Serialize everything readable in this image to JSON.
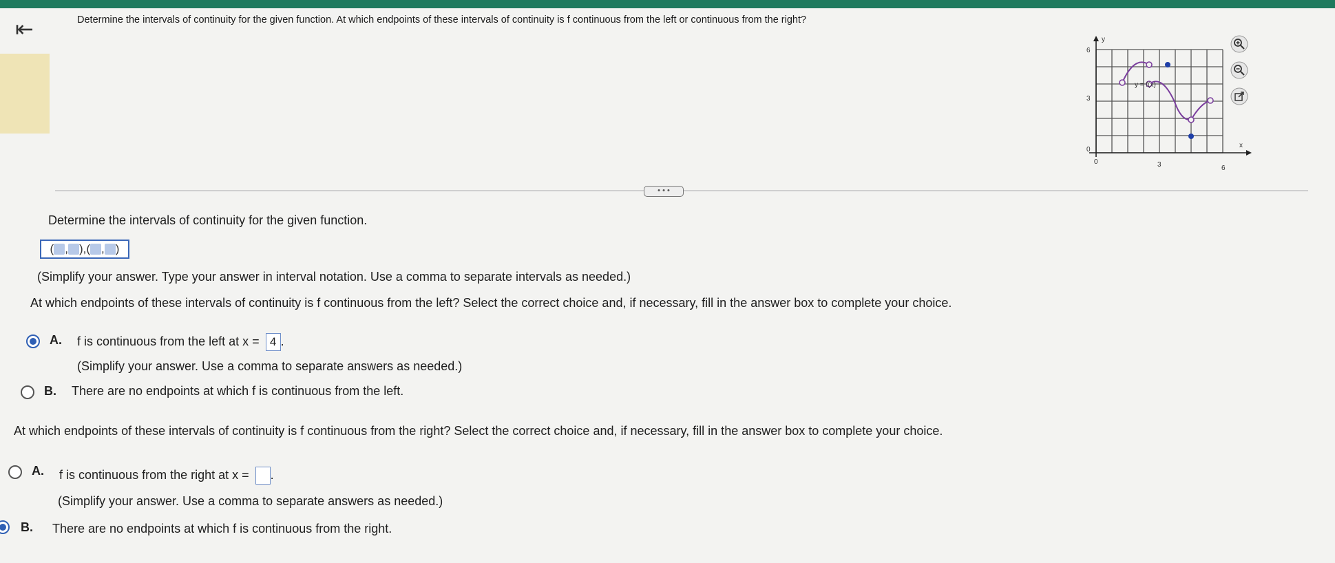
{
  "header": {
    "back_icon": "back-arrow-icon",
    "question": "Determine the intervals of continuity for the given function. At which endpoints of these intervals of continuity is f continuous from the left or continuous from the right?"
  },
  "graph": {
    "y_axis_label": "y",
    "x_axis_label": "x",
    "y_ticks": [
      "6",
      "3",
      "0"
    ],
    "x_ticks": [
      "0",
      "3",
      "6"
    ],
    "function_label": "y = f(x)",
    "colors": {
      "curve": "#7b3f9e",
      "point": "#1f3fa8",
      "grid": "#444444"
    }
  },
  "tools": [
    "zoom-in-icon",
    "zoom-out-icon",
    "popout-icon"
  ],
  "more_button": "• • •",
  "part1": {
    "prompt": "Determine the intervals of continuity for the given function.",
    "answer_template": {
      "open": "(",
      "comma": ",",
      "close": ")",
      "separator": ",",
      "ph1": "",
      "ph2": "",
      "ph3": "",
      "ph4": ""
    },
    "instruction": "(Simplify your answer. Type your answer in interval notation. Use a comma to separate intervals as needed.)"
  },
  "part2": {
    "prompt": "At which endpoints of these intervals of continuity is f continuous from the left? Select the correct choice and, if necessary, fill in the answer box to complete your choice.",
    "choice_a": {
      "letter": "A.",
      "text": "f is continuous from the left at x =",
      "value": "4",
      "period": ".",
      "note": "(Simplify your answer. Use a comma to separate answers as needed.)",
      "selected": true
    },
    "choice_b": {
      "letter": "B.",
      "text": "There are no endpoints at which f is continuous from the left.",
      "selected": false
    }
  },
  "part3": {
    "prompt": "At which endpoints of these intervals of continuity is f continuous from the right? Select the correct choice and, if necessary, fill in the answer box to complete your choice.",
    "choice_a": {
      "letter": "A.",
      "text": "f is continuous from the right at x =",
      "value": "",
      "period": ".",
      "note": "(Simplify your answer. Use a comma to separate answers as needed.)",
      "selected": false
    },
    "choice_b": {
      "letter": "B.",
      "text": "There are no endpoints at which f is continuous from the right.",
      "selected": true
    }
  }
}
